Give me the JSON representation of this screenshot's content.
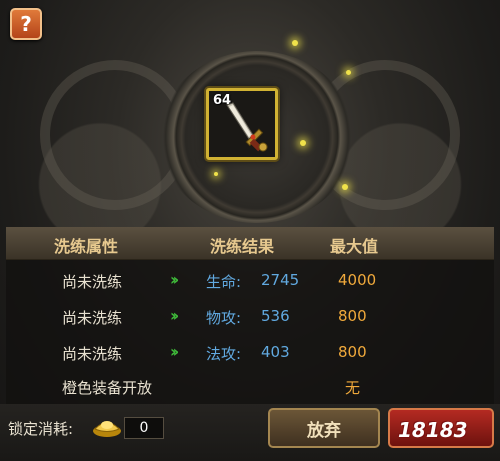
{
  "item": {
    "level": "64"
  },
  "table": {
    "headers": {
      "attribute": "洗练属性",
      "result": "洗练结果",
      "max": "最大值"
    },
    "rows": [
      {
        "status": "尚未洗练",
        "stat": "生命",
        "value": "2745",
        "max": "4000"
      },
      {
        "status": "尚未洗练",
        "stat": "物攻",
        "value": "536",
        "max": "800"
      },
      {
        "status": "尚未洗练",
        "stat": "法攻",
        "value": "403",
        "max": "800"
      }
    ],
    "orange_unlock": {
      "label": "橙色装备开放",
      "max": "无"
    }
  },
  "footer": {
    "lock_cost_label": "锁定消耗:",
    "lock_cost_value": "0",
    "abandon_label": "放弃"
  },
  "help": {
    "label": "?"
  },
  "watermark": {
    "text": "18183"
  },
  "colors": {
    "stat_blue": "#61a9e0",
    "max_orange": "#f0a93b",
    "arrow_green": "#3fbb3a",
    "gold_border": "#d1b233"
  }
}
